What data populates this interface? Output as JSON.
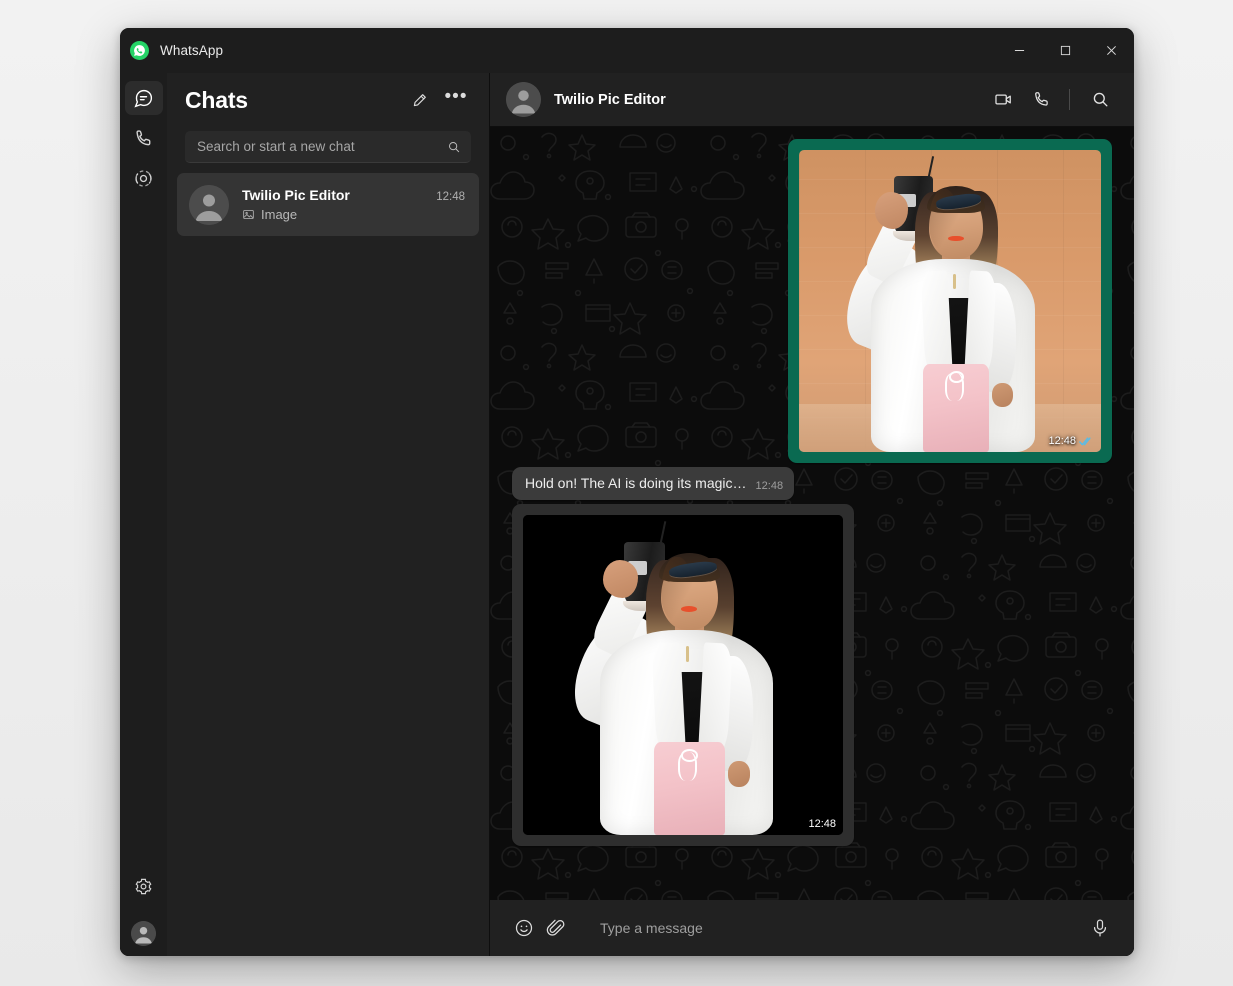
{
  "window": {
    "app_title": "WhatsApp",
    "logo_icon": "whatsapp-logo-icon",
    "controls": {
      "minimize": "minimize-icon",
      "maximize": "maximize-icon",
      "close": "close-icon"
    }
  },
  "rail": {
    "items": [
      {
        "name": "chats",
        "icon": "chats-icon",
        "active": true
      },
      {
        "name": "calls",
        "icon": "phone-icon",
        "active": false
      },
      {
        "name": "status",
        "icon": "status-icon",
        "active": false
      }
    ],
    "bottom": [
      {
        "name": "settings",
        "icon": "gear-icon"
      },
      {
        "name": "profile",
        "icon": "avatar-icon"
      }
    ],
    "accent_color": "#00d06a"
  },
  "pane": {
    "title": "Chats",
    "new_chat_icon": "new-chat-icon",
    "menu_icon": "overflow-menu-icon",
    "menu_label": "•••",
    "search": {
      "placeholder": "Search or start a new chat",
      "value": "",
      "icon": "search-icon"
    },
    "chats": [
      {
        "name": "Twilio Pic Editor",
        "time": "12:48",
        "preview": "Image",
        "preview_icon": "image-icon",
        "selected": true
      }
    ]
  },
  "conversation": {
    "contact_name": "Twilio Pic Editor",
    "avatar_icon": "avatar-icon",
    "actions": [
      {
        "name": "video-call",
        "icon": "video-camera-icon"
      },
      {
        "name": "voice-call",
        "icon": "phone-icon"
      },
      {
        "name": "search-chat",
        "icon": "search-icon"
      }
    ],
    "messages": [
      {
        "id": "m1",
        "direction": "out",
        "type": "image",
        "alt": "Woman in white shirt holding a coffee cup in front of an orange brick wall",
        "time": "12:48",
        "status": "read",
        "status_icon": "double-check-icon",
        "bubble_color": "#0a6a51"
      },
      {
        "id": "m2",
        "direction": "in",
        "type": "text",
        "text": "Hold on! The AI is doing its magic…",
        "time": "12:48",
        "bubble_color": "#3b3b3b"
      },
      {
        "id": "m3",
        "direction": "in",
        "type": "image",
        "alt": "Same woman with the background removed, now on a black background",
        "time": "12:48",
        "bubble_color": "#2e2e2e"
      }
    ]
  },
  "composer": {
    "emoji_icon": "emoji-icon",
    "attach_icon": "paperclip-icon",
    "mic_icon": "microphone-icon",
    "placeholder": "Type a message",
    "value": ""
  },
  "colors": {
    "window_bg": "#111111",
    "titlebar": "#1d1d1d",
    "panel": "#212121",
    "chat_bg": "#0c0c0c",
    "accent_green": "#00d06a",
    "outgoing_green": "#0a6a51",
    "tick_blue": "#53bdeb"
  }
}
